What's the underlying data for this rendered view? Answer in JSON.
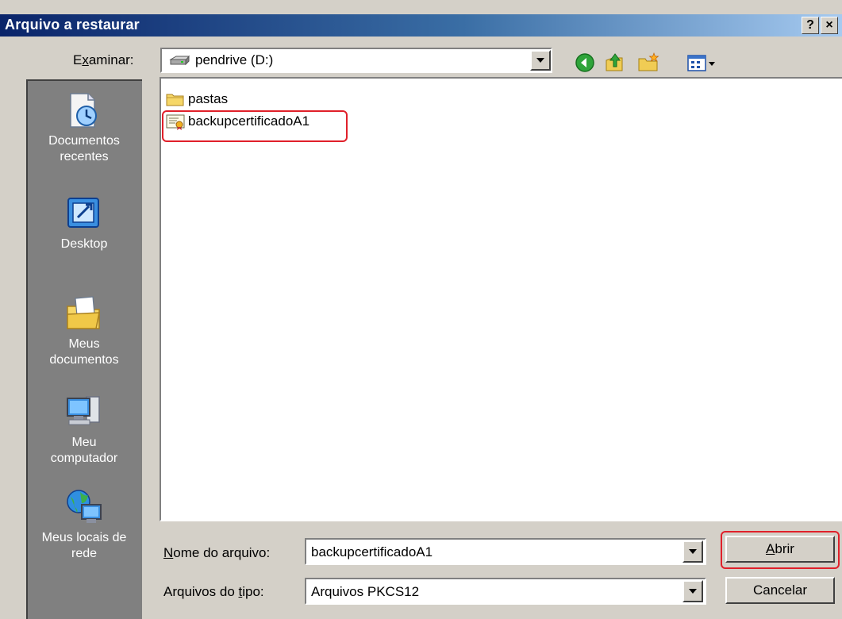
{
  "dialog": {
    "title": "Arquivo a restaurar",
    "help_glyph": "?",
    "close_glyph": "×"
  },
  "look_in": {
    "label_pre": "E",
    "label_u": "x",
    "label_post": "aminar:",
    "value": "pendrive (D:)",
    "icon": "drive-icon"
  },
  "toolbar": {
    "icons": [
      "back-icon",
      "up-folder-icon",
      "new-folder-icon",
      "view-menu-icon"
    ]
  },
  "places": [
    {
      "line1": "Documentos",
      "line2": "recentes",
      "icon": "recent-documents-icon"
    },
    {
      "line1": "Desktop",
      "line2": "",
      "icon": "desktop-icon"
    },
    {
      "line1": "Meus",
      "line2": "documentos",
      "icon": "my-documents-icon"
    },
    {
      "line1": "Meu",
      "line2": "computador",
      "icon": "my-computer-icon"
    },
    {
      "line1": "Meus locais de",
      "line2": "rede",
      "icon": "network-places-icon"
    }
  ],
  "files": [
    {
      "name": "pastas",
      "icon": "folder-icon"
    },
    {
      "name": "backupcertificadoA1",
      "icon": "certificate-icon"
    }
  ],
  "filename": {
    "label_u": "N",
    "label_rest": "ome do arquivo:",
    "value": "backupcertificadoA1"
  },
  "filetype": {
    "label_pre": "Arquivos do ",
    "label_u": "t",
    "label_post": "ipo:",
    "value": "Arquivos PKCS12"
  },
  "buttons": {
    "open_u": "A",
    "open_rest": "brir",
    "cancel": "Cancelar"
  },
  "colors": {
    "titlebar_start": "#0a246a",
    "titlebar_end": "#a6caf0",
    "highlight": "#e0202a",
    "dialog_bg": "#d4d0c8"
  }
}
